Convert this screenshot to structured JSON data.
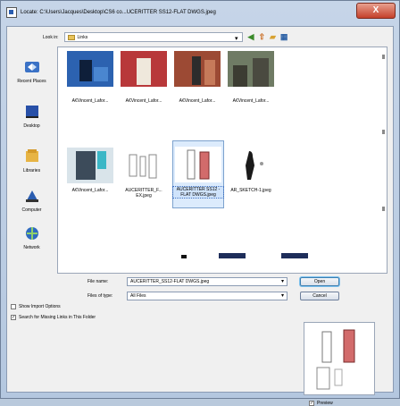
{
  "window": {
    "title": "Locate: C:\\Users\\Jacques\\Desktop\\CS6 co...UCERITTER SS12-FLAT DWGS.jpeg",
    "close_label": "X"
  },
  "lookin": {
    "label": "Look in:",
    "value": "Links"
  },
  "places": [
    {
      "label": "Recent Places",
      "icon": "recent-places-icon"
    },
    {
      "label": "Desktop",
      "icon": "desktop-icon"
    },
    {
      "label": "Libraries",
      "icon": "libraries-icon"
    },
    {
      "label": "Computer",
      "icon": "computer-icon"
    },
    {
      "label": "Network",
      "icon": "network-icon"
    }
  ],
  "files": [
    {
      "caption": "",
      "kind": "photo-blue"
    },
    {
      "caption": "",
      "kind": "photo-red"
    },
    {
      "caption": "",
      "kind": "photo-brick"
    },
    {
      "caption": "",
      "kind": "photo-street"
    },
    {
      "caption": "A€Vincent_Lafor...",
      "kind": "none"
    },
    {
      "caption": "A€Vincent_Lafor...",
      "kind": "none"
    },
    {
      "caption": "A€Vincent_Lafor...",
      "kind": "none"
    },
    {
      "caption": "A€Vincent_Lafor...",
      "kind": "none"
    },
    {
      "caption": "A€Vincent_Lafor...",
      "kind": "photo-cyan"
    },
    {
      "caption": "AUCERITTER_F... EX.jpeg",
      "kind": "sketch-flat"
    },
    {
      "caption": "AUCERITTER SS12 -FLAT DWGS.jpeg",
      "kind": "sketch-sel"
    },
    {
      "caption": "AR_SKETCH-1.jpeg",
      "kind": "sketch-figure"
    }
  ],
  "filename": {
    "label": "File name:",
    "value": "AUCERITTER_SS12-FLAT DWGS.jpeg"
  },
  "filetype": {
    "label": "Files of type:",
    "value": "All Files"
  },
  "buttons": {
    "open": "Open",
    "cancel": "Cancel"
  },
  "options": {
    "show_import": "Show Import Options",
    "search_missing": "Search for Missing Links in This Folder",
    "show_import_checked": false,
    "search_missing_checked": true
  },
  "preview": {
    "label": "Preview",
    "checked": true
  }
}
